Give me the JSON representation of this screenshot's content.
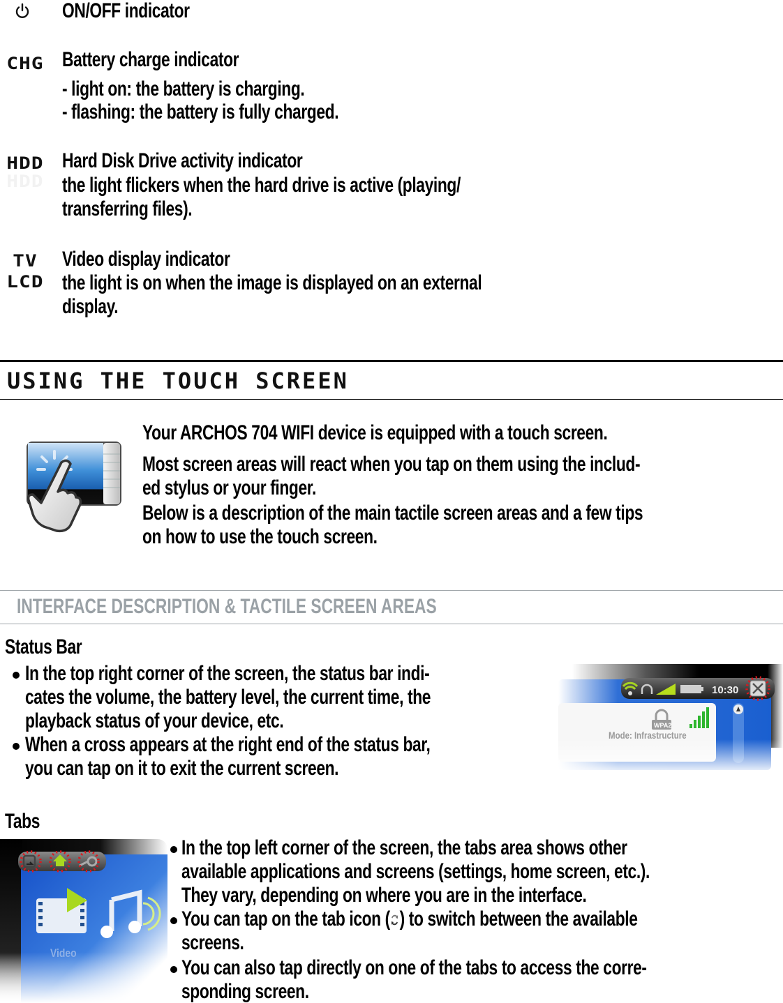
{
  "indicators": [
    {
      "icon": "power-icon",
      "label": "",
      "title": "ON/OFF indicator",
      "lines": []
    },
    {
      "icon": "chg-label",
      "label": "CHG",
      "title": "Battery charge indicator",
      "lines": [
        "- light on: the battery is charging.",
        "- flashing: the battery is fully charged."
      ]
    },
    {
      "icon": "hdd-label",
      "label": "HDD",
      "title": "Hard Disk Drive activity indicator",
      "lines": [
        "the light flickers when the hard drive is active (playing/",
        "transferring files)."
      ]
    },
    {
      "icon": "tv-lcd-label",
      "label": "TV",
      "label2": "LCD",
      "title": "Video display indicator",
      "lines": [
        "the light is on when the image is displayed on an external",
        "display."
      ]
    }
  ],
  "section": {
    "title": "USING THE TOUCH SCREEN",
    "intro": [
      "Your ARCHOS 704 WIFI device is equipped with a touch screen.",
      "Most screen areas will react when you tap on them using the includ-",
      "ed stylus or your finger.",
      "Below is a description of the main tactile screen areas and a few tips",
      "on how to use the touch screen."
    ]
  },
  "subsection": {
    "title": "INTERFACE DESCRIPTION & TACTILE SCREEN AREAS"
  },
  "status_bar": {
    "heading": "Status Bar",
    "bullets": [
      [
        "In the top right corner of the screen, the status bar indi-",
        "cates the volume, the battery level, the current time, the",
        "playback status of your device, etc."
      ],
      [
        "When a cross appears at the right end of the status bar,",
        "you can tap on it to exit the current screen."
      ]
    ],
    "screenshot": {
      "time": "10:30",
      "mode_text": "Mode: Infrastructure",
      "security_badge": "WPA2"
    }
  },
  "tabs": {
    "heading": "Tabs",
    "bullets": [
      [
        "In the top left corner of the screen, the tabs area shows other",
        "available applications and screens (settings, home screen, etc.).",
        "They vary, depending on where you are in the interface."
      ],
      [
        "You can tap on the tab icon (",
        ") to switch between the available",
        "screens."
      ],
      [
        "You can also tap directly on one of the tabs to access the corre-",
        "sponding screen."
      ]
    ],
    "screenshot": {
      "video_label": "Video"
    }
  },
  "colors": {
    "grey_heading": "#9aa1a6",
    "highlight_red": "#e0161b",
    "screen_blue": "#1a5fd0",
    "accent_green": "#9ad11a"
  }
}
